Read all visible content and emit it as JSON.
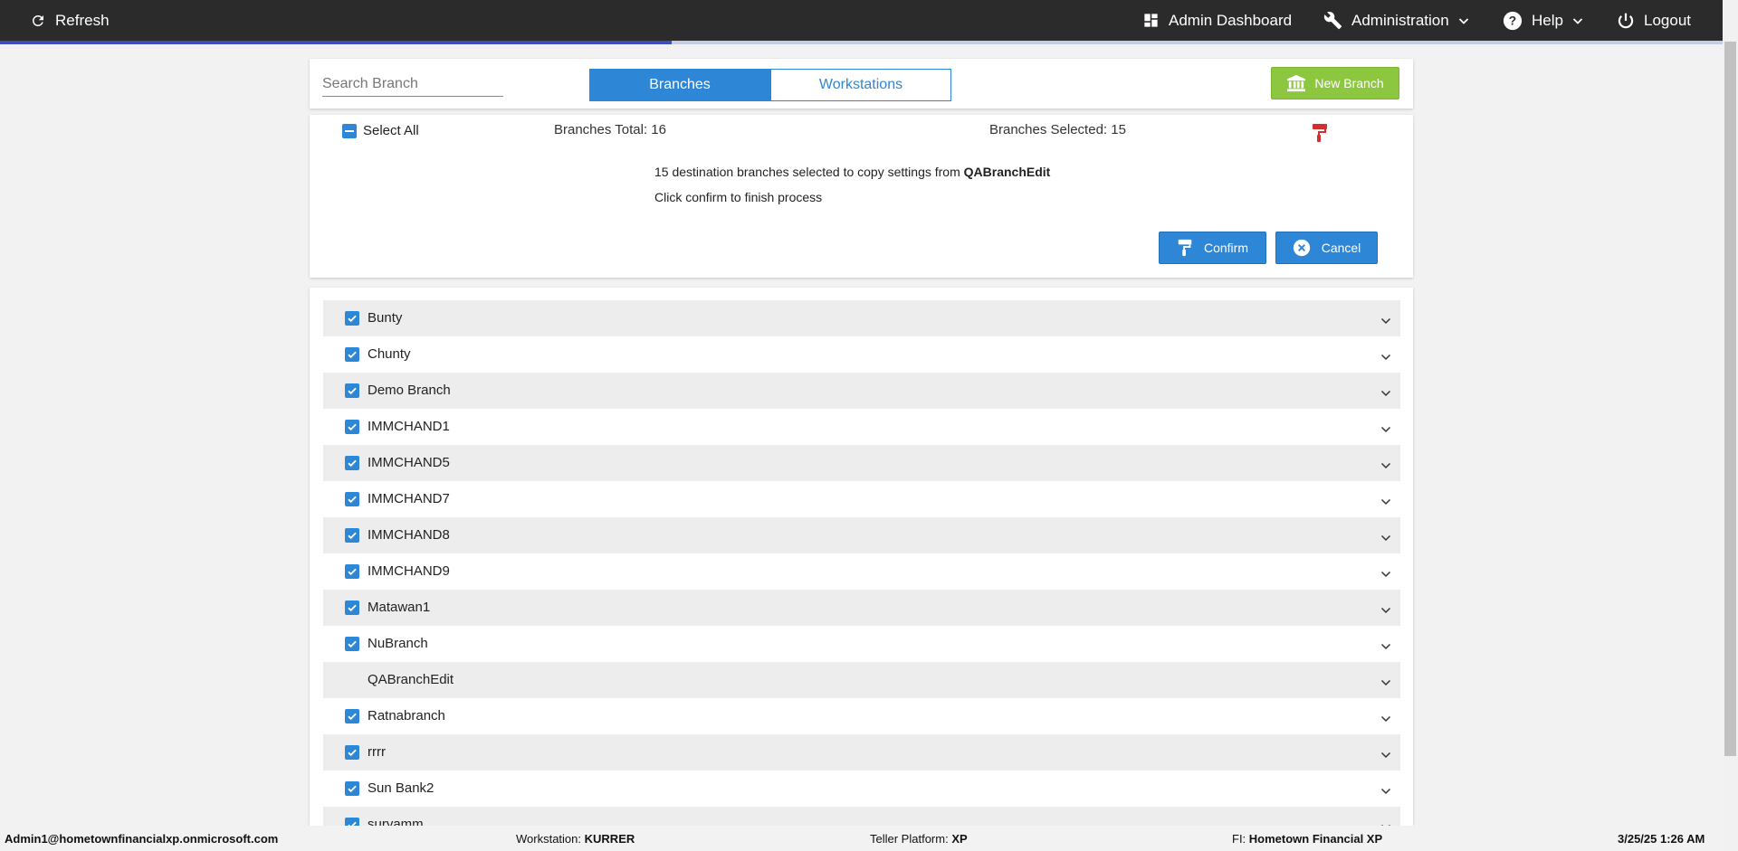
{
  "topbar": {
    "refresh_label": "Refresh",
    "admin_dashboard_label": "Admin Dashboard",
    "administration_label": "Administration",
    "help_label": "Help",
    "logout_label": "Logout",
    "progress_fraction": 0.39
  },
  "toolbar": {
    "search_placeholder": "Search Branch",
    "search_value": "",
    "tab_branches": "Branches",
    "tab_workstations": "Workstations",
    "active_tab": "Branches",
    "new_branch_label": "New Branch"
  },
  "selection": {
    "select_all_label": "Select All",
    "total_label": "Branches Total:",
    "total_value": "16",
    "selected_label": "Branches Selected:",
    "selected_value": "15",
    "message_prefix": "15 destination branches selected to copy settings from",
    "source_branch": "QABranchEdit",
    "message_line2": "Click confirm to finish process",
    "confirm_label": "Confirm",
    "cancel_label": "Cancel"
  },
  "branches": [
    {
      "name": "Bunty",
      "checked": true
    },
    {
      "name": "Chunty",
      "checked": true
    },
    {
      "name": "Demo Branch",
      "checked": true
    },
    {
      "name": "IMMCHAND1",
      "checked": true
    },
    {
      "name": "IMMCHAND5",
      "checked": true
    },
    {
      "name": "IMMCHAND7",
      "checked": true
    },
    {
      "name": "IMMCHAND8",
      "checked": true
    },
    {
      "name": "IMMCHAND9",
      "checked": true
    },
    {
      "name": "Matawan1",
      "checked": true
    },
    {
      "name": "NuBranch",
      "checked": true
    },
    {
      "name": "QABranchEdit",
      "checked": false
    },
    {
      "name": "Ratnabranch",
      "checked": true
    },
    {
      "name": "rrrr",
      "checked": true
    },
    {
      "name": "Sun Bank2",
      "checked": true
    },
    {
      "name": "suryamm",
      "checked": true
    }
  ],
  "footer": {
    "user": "Admin1@hometownfinancialxp.onmicrosoft.com",
    "workstation_label": "Workstation:",
    "workstation_value": "KURRER",
    "platform_label": "Teller Platform:",
    "platform_value": "XP",
    "fi_label": "FI:",
    "fi_value": "Hometown Financial XP",
    "datetime": "3/25/25 1:26 AM"
  },
  "colors": {
    "accent_blue": "#2e86d6",
    "new_branch_green": "#8dc63f",
    "topbar_dark": "#2b2b2b",
    "brush_red": "#d32f2f"
  }
}
